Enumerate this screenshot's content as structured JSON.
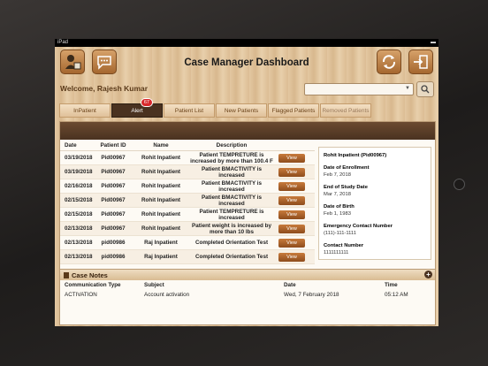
{
  "statusbar": {
    "device": "iPad",
    "battery": "▬"
  },
  "header": {
    "title": "Case Manager Dashboard"
  },
  "welcome": {
    "text": "Welcome, Rajesh Kumar"
  },
  "tabs": [
    {
      "label": "InPatient"
    },
    {
      "label": "Alert",
      "badge": "67"
    },
    {
      "label": "Patient List"
    },
    {
      "label": "New Patients"
    },
    {
      "label": "Flagged Patients"
    },
    {
      "label": "Removed Patients"
    }
  ],
  "table": {
    "headers": [
      "Date",
      "Patient ID",
      "Name",
      "Description"
    ],
    "view_label": "View",
    "rows": [
      {
        "date": "03/19/2018",
        "id": "Pid00967",
        "name": "Rohit Inpatient",
        "desc": "Patient TEMPRETURE is increased by more than  100.4 F"
      },
      {
        "date": "03/19/2018",
        "id": "Pid00967",
        "name": "Rohit Inpatient",
        "desc": "Patient BMACTIVITY is increased"
      },
      {
        "date": "02/16/2018",
        "id": "Pid00967",
        "name": "Rohit Inpatient",
        "desc": "Patient BMACTIVITY is increased"
      },
      {
        "date": "02/15/2018",
        "id": "Pid00967",
        "name": "Rohit Inpatient",
        "desc": "Patient BMACTIVITY is increased"
      },
      {
        "date": "02/15/2018",
        "id": "Pid00967",
        "name": "Rohit Inpatient",
        "desc": "Patient TEMPRETURE is increased"
      },
      {
        "date": "02/13/2018",
        "id": "Pid00967",
        "name": "Rohit Inpatient",
        "desc": "Patient weight is increased by more than 10 lbs"
      },
      {
        "date": "02/13/2018",
        "id": "pid00986",
        "name": "Raj Inpatient",
        "desc": "Completed Orientation Test"
      },
      {
        "date": "02/13/2018",
        "id": "pid00986",
        "name": "Raj Inpatient",
        "desc": "Completed Orientation Test"
      }
    ]
  },
  "detail": {
    "name": "Rohit Inpatient (Pid00967)",
    "enroll_label": "Date of Enrollment",
    "enroll": "Feb 7, 2018",
    "end_label": "End of Study Date",
    "end": "Mar 7, 2018",
    "dob_label": "Date of Birth",
    "dob": "Feb 1, 1983",
    "emerg_label": "Emergency Contact Number",
    "emerg": "(111)-111-1111",
    "contact_label": "Contact Number",
    "contact": "1111111111"
  },
  "notes": {
    "title": "Case Notes",
    "headers": [
      "Communication Type",
      "Subject",
      "Date",
      "Time"
    ],
    "row": {
      "type": "ACTIVATION",
      "subject": "Account activation",
      "date": "Wed, 7 February 2018",
      "time": "05:12 AM"
    }
  }
}
